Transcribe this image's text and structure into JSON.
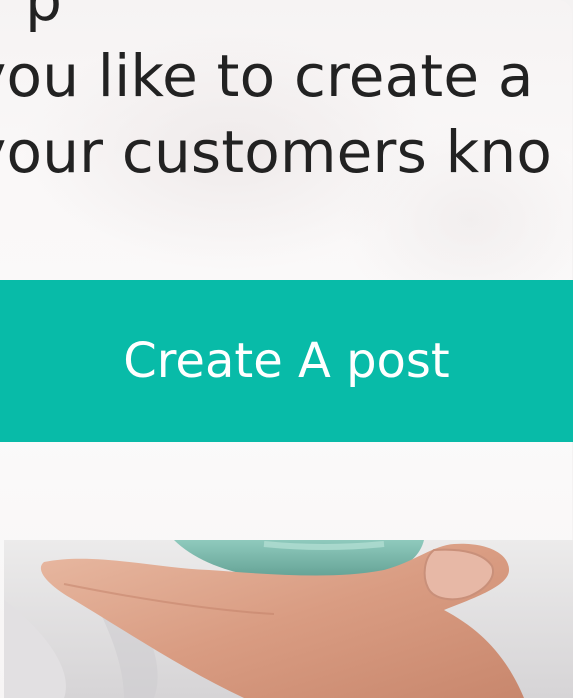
{
  "promo": {
    "headline_line1": "y    p",
    "headline_line2": "you like to create a",
    "headline_line3": "your customers kno",
    "cta_label": "Create A post"
  },
  "colors": {
    "accent": "#08bba8",
    "text": "#222222",
    "background": "#f7f5f5"
  }
}
